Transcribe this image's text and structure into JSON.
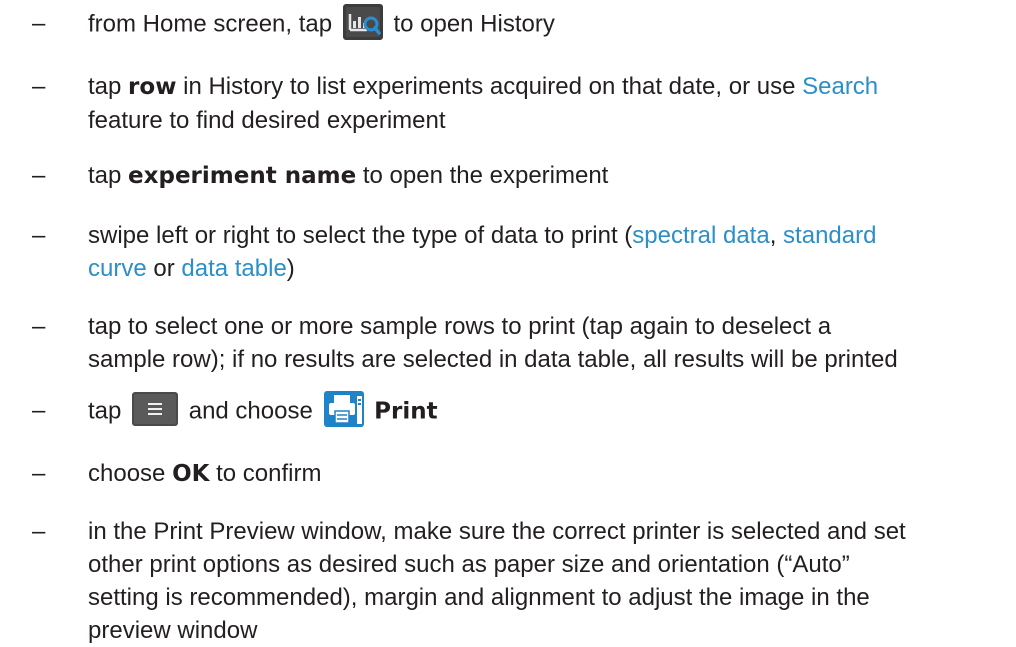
{
  "dash": "–",
  "steps": {
    "s1": {
      "a": "from Home screen, tap",
      "b": "to open History",
      "icon": "history-icon"
    },
    "s2": {
      "a": "tap",
      "b": "row",
      "c": "in History to list experiments acquired on that date, or use",
      "d": "Search",
      "e": "feature to find desired experiment"
    },
    "s3": {
      "a": "tap",
      "b": "experiment name",
      "c": "to open the experiment"
    },
    "s4": {
      "a": "swipe left or right to select the type of data to print (",
      "b": "spectral data",
      "c": ",",
      "d": "standard",
      "e": "curve",
      "f": "or",
      "g": "data table",
      "h": ")"
    },
    "s5": {
      "a": "tap to select one or more sample rows to print (tap again to deselect a",
      "b": "sample row); if no results are selected in data table, all results will be printed"
    },
    "s6": {
      "a": "tap",
      "b": "and choose",
      "c": "Print",
      "icon1": "menu-icon",
      "icon2": "print-icon"
    },
    "s7": {
      "a": "choose",
      "b": "OK",
      "c": "to confirm"
    },
    "s8": {
      "l1": "in the Print Preview window, make sure the correct printer is selected and set",
      "l2": "other print options as desired such as paper size and orientation (“Auto”",
      "l3": "setting is recommended), margin and alignment to adjust the image in the",
      "l4": "preview window"
    }
  },
  "colors": {
    "text": "#231f20",
    "link": "#2b8fc9",
    "history_icon_bg": "#3c3c3c",
    "history_icon_accent": "#2a8fd0",
    "menu_button_bg": "#4a4a4a",
    "print_icon_bg": "#1f83c9"
  }
}
